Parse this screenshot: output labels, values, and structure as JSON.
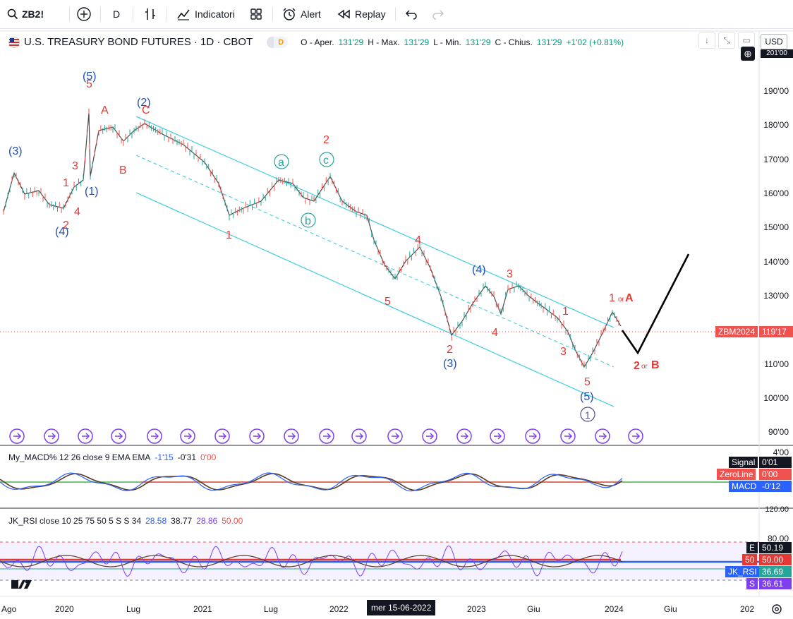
{
  "toolbar": {
    "symbol": "ZB2!",
    "interval": "D",
    "indicators_label": "Indicatori",
    "alert_label": "Alert",
    "replay_label": "Replay"
  },
  "header": {
    "title": "U.S. TREASURY BOND FUTURES · 1D · CBOT",
    "d_badge": "D",
    "open_label": "O - Aper.",
    "open": "131'29",
    "high_label": "H - Max.",
    "high": "131'29",
    "low_label": "L - Min.",
    "low": "131'29",
    "close_label": "C - Chius.",
    "close": "131'29",
    "change": "+1'02 (+0.81%)",
    "currency": "USD"
  },
  "price_axis": [
    "190'00",
    "180'00",
    "170'00",
    "160'00",
    "150'00",
    "140'00",
    "130'00",
    "110'00",
    "100'00",
    "90'00"
  ],
  "price_axis_top_partial": "201'00",
  "current_tag": {
    "name": "ZBM2024",
    "value": "119'17",
    "color": "#ef5350"
  },
  "macd": {
    "title": "My_MACD% 12 26 close 9 EMA EMA",
    "v1": "-1'15",
    "v2": "-0'31",
    "v3": "0'00",
    "axis_top": "4'00",
    "axis_bottom_partial": "120.00",
    "signal_label": "Signal",
    "signal_value": "0'01",
    "zeroline_label": "ZeroLine",
    "zeroline_value": "0'00",
    "macd_label": "MACD",
    "macd_value": "-0'12"
  },
  "rsi": {
    "title": "JK_RSI close 10 25 75 50 5 S S 34",
    "v1": "28.58",
    "v2": "38.77",
    "v3": "28.86",
    "v4": "50.00",
    "axis_top": "80.00",
    "e_label": "E",
    "e_value": "50.19",
    "mid_value": "50",
    "mid_value2": "50.00",
    "rsi_label": "JK_RSI",
    "rsi_value": "36.69",
    "s_label": "S",
    "s_value": "36.61"
  },
  "time_axis": [
    "Ago",
    "2020",
    "Lug",
    "2021",
    "Lug",
    "2022",
    "2023",
    "Giu",
    "2024",
    "Giu",
    "202"
  ],
  "crosshair_date": "mer 15-06-2022",
  "wave_labels": {
    "blue": [
      "(5)",
      "(3)",
      "(4)",
      "(1)",
      "(2)",
      "(4)",
      "(3)",
      "(5)"
    ],
    "red": [
      "5",
      "A",
      "C",
      "3",
      "1",
      "4",
      "2",
      "B",
      "2",
      "1",
      "4",
      "3",
      "5",
      "2",
      "1",
      "4",
      "3",
      "5",
      "1",
      "A",
      "2",
      "B"
    ],
    "red_small_or": "or",
    "green": [
      "a",
      "c",
      "b"
    ],
    "circled": "1",
    "red_minor_1": "1",
    "red_minor_3": "3"
  },
  "colors": {
    "channel": "#4dd0e1",
    "wave_red": "#e53935",
    "wave_blue": "#1e4fb5",
    "wave_green": "#26a69a",
    "purple": "#7e3ff2",
    "price_tag": "#ef5350"
  },
  "icons": {
    "add": "plus-circle-icon",
    "bars": "bar-chart-icon",
    "indicators": "indicators-icon",
    "layout": "layout-grid-icon",
    "alert": "alarm-clock-icon",
    "replay": "rewind-icon",
    "undo": "undo-icon",
    "redo": "redo-icon",
    "settings": "gear-icon"
  }
}
